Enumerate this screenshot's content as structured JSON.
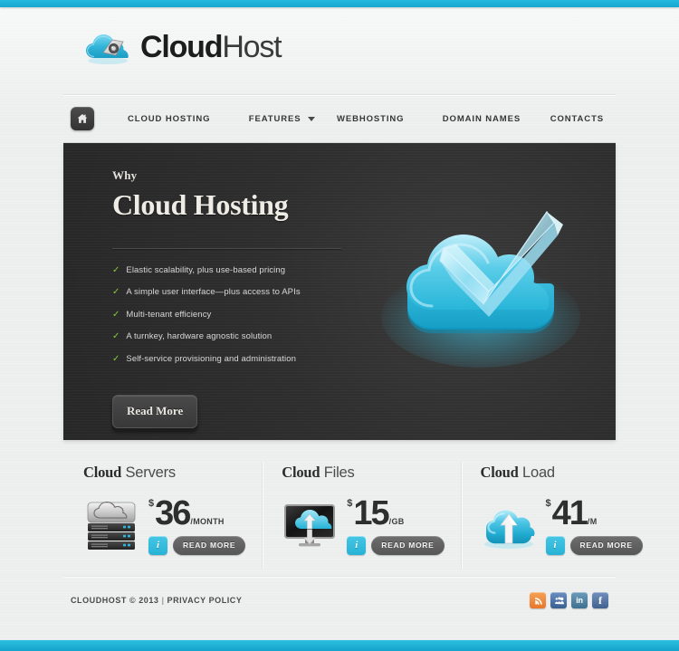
{
  "site": {
    "logo_brand": "Cloud",
    "logo_suffix": "Host",
    "logo_icon": "cloud-logo-icon"
  },
  "nav": {
    "home_icon": "home-icon",
    "dropdown_icon": "chevron-down-icon",
    "items": [
      {
        "label": "CLOUD HOSTING"
      },
      {
        "label": "FEATURES"
      },
      {
        "label": "WEBHOSTING"
      },
      {
        "label": "DOMAIN NAMES"
      },
      {
        "label": "CONTACTS"
      }
    ]
  },
  "hero": {
    "eyebrow": "Why",
    "title": "Cloud Hosting",
    "features": [
      "Elastic scalability, plus use-based pricing",
      "A simple user interface—plus access to APIs",
      "Multi-tenant efficiency",
      "A turnkey, hardware agnostic solution",
      "Self-service provisioning and administration"
    ],
    "tick_icon": "check-icon",
    "tick_color": "#8cc63e",
    "button_label": "Read More",
    "art_icon": "cloud-checkmark-illustration"
  },
  "pricing": {
    "info_label": "i",
    "read_more_label": "READ MORE",
    "currency": "$",
    "columns": [
      {
        "title_bold": "Cloud",
        "title_light": " Servers",
        "amount": "36",
        "unit": "/MONTH",
        "icon": "server-rack-icon"
      },
      {
        "title_bold": "Cloud",
        "title_light": " Files",
        "amount": "15",
        "unit": "/GB",
        "icon": "monitor-cloud-sync-icon"
      },
      {
        "title_bold": "Cloud",
        "title_light": " Load",
        "amount": "41",
        "unit": "/M",
        "icon": "cloud-upload-icon"
      }
    ]
  },
  "footer": {
    "copyright": "CLOUDHOST © 2013",
    "separator": "|",
    "privacy_label": "PRIVACY POLICY",
    "social": [
      {
        "name": "rss-icon",
        "glyph": "◔",
        "color": "#f08c3a"
      },
      {
        "name": "myspace-icon",
        "glyph": "✦",
        "color": "#4a6fa5"
      },
      {
        "name": "linkedin-icon",
        "glyph": "in",
        "color": "#4a7f9e"
      },
      {
        "name": "facebook-icon",
        "glyph": "f",
        "color": "#51709e"
      }
    ]
  },
  "theme": {
    "accent": "#23b5d6",
    "hero_bg": "#2f2f2f",
    "page_bg": "#eff0f0"
  }
}
